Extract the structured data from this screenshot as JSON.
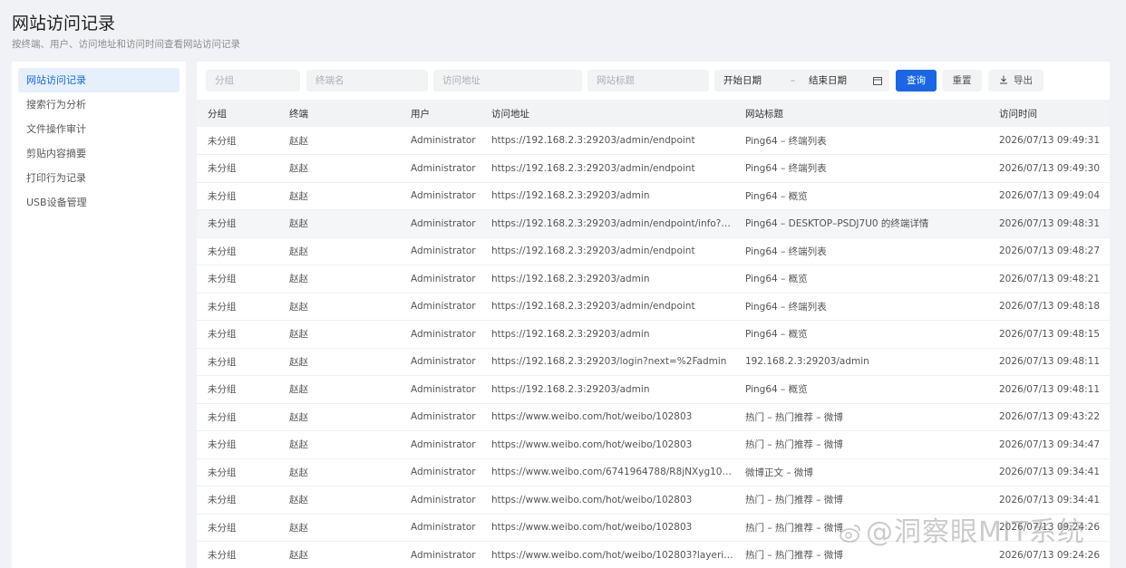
{
  "header": {
    "title": "网站访问记录",
    "subtitle": "按终端、用户、访问地址和访问时间查看网站访问记录"
  },
  "sidebar": {
    "items": [
      {
        "label": "网站访问记录",
        "active": true
      },
      {
        "label": "搜索行为分析",
        "active": false
      },
      {
        "label": "文件操作审计",
        "active": false
      },
      {
        "label": "剪贴内容摘要",
        "active": false
      },
      {
        "label": "打印行为记录",
        "active": false
      },
      {
        "label": "USB设备管理",
        "active": false
      }
    ]
  },
  "toolbar": {
    "group_placeholder": "分组",
    "endpoint_placeholder": "终端名",
    "url_placeholder": "访问地址",
    "site_title_placeholder": "网站标题",
    "start_date": "开始日期",
    "date_separator": "–",
    "end_date": "结束日期",
    "query_label": "查询",
    "reset_label": "重置",
    "export_label": "导出"
  },
  "table": {
    "columns": [
      "分组",
      "终端",
      "用户",
      "访问地址",
      "网站标题",
      "访问时间"
    ],
    "rows": [
      [
        "未分组",
        "赵赵",
        "Administrator",
        "https://192.168.2.3:29203/admin/endpoint",
        "Ping64 – 终端列表",
        "2026/07/13 09:49:31"
      ],
      [
        "未分组",
        "赵赵",
        "Administrator",
        "https://192.168.2.3:29203/admin/endpoint",
        "Ping64 – 终端列表",
        "2026/07/13 09:49:30"
      ],
      [
        "未分组",
        "赵赵",
        "Administrator",
        "https://192.168.2.3:29203/admin",
        "Ping64 – 概览",
        "2026/07/13 09:49:04"
      ],
      [
        "未分组",
        "赵赵",
        "Administrator",
        "https://192.168.2.3:29203/admin/endpoint/info?u…",
        "Ping64 – DESKTOP–PSDJ7U0 的终端详情",
        "2026/07/13 09:48:31"
      ],
      [
        "未分组",
        "赵赵",
        "Administrator",
        "https://192.168.2.3:29203/admin/endpoint",
        "Ping64 – 终端列表",
        "2026/07/13 09:48:27"
      ],
      [
        "未分组",
        "赵赵",
        "Administrator",
        "https://192.168.2.3:29203/admin",
        "Ping64 – 概览",
        "2026/07/13 09:48:21"
      ],
      [
        "未分组",
        "赵赵",
        "Administrator",
        "https://192.168.2.3:29203/admin/endpoint",
        "Ping64 – 终端列表",
        "2026/07/13 09:48:18"
      ],
      [
        "未分组",
        "赵赵",
        "Administrator",
        "https://192.168.2.3:29203/admin",
        "Ping64 – 概览",
        "2026/07/13 09:48:15"
      ],
      [
        "未分组",
        "赵赵",
        "Administrator",
        "https://192.168.2.3:29203/login?next=%2Fadmin",
        "192.168.2.3:29203/admin",
        "2026/07/13 09:48:11"
      ],
      [
        "未分组",
        "赵赵",
        "Administrator",
        "https://192.168.2.3:29203/admin",
        "Ping64 – 概览",
        "2026/07/13 09:48:11"
      ],
      [
        "未分组",
        "赵赵",
        "Administrator",
        "https://www.weibo.com/hot/weibo/102803",
        "热门 – 热门推荐 – 微博",
        "2026/07/13 09:43:22"
      ],
      [
        "未分组",
        "赵赵",
        "Administrator",
        "https://www.weibo.com/hot/weibo/102803",
        "热门 – 热门推荐 – 微博",
        "2026/07/13 09:34:47"
      ],
      [
        "未分组",
        "赵赵",
        "Administrator",
        "https://www.weibo.com/6741964788/R8jNXyg10…",
        "微博正文 – 微博",
        "2026/07/13 09:34:41"
      ],
      [
        "未分组",
        "赵赵",
        "Administrator",
        "https://www.weibo.com/hot/weibo/102803",
        "热门 – 热门推荐 – 微博",
        "2026/07/13 09:34:41"
      ],
      [
        "未分组",
        "赵赵",
        "Administrator",
        "https://www.weibo.com/hot/weibo/102803",
        "热门 – 热门推荐 – 微博",
        "2026/07/13 09:24:26"
      ],
      [
        "未分组",
        "赵赵",
        "Administrator",
        "https://www.weibo.com/hot/weibo/102803?layeri…",
        "热门 – 热门推荐 – 微博",
        "2026/07/13 09:24:26"
      ]
    ],
    "highlighted_row": 3
  },
  "watermark": "@洞察眼MIT系统",
  "colors": {
    "accent": "#1a66e6",
    "sidebar_active_bg": "#e6f0fd",
    "page_bg": "#f0f2f5"
  }
}
